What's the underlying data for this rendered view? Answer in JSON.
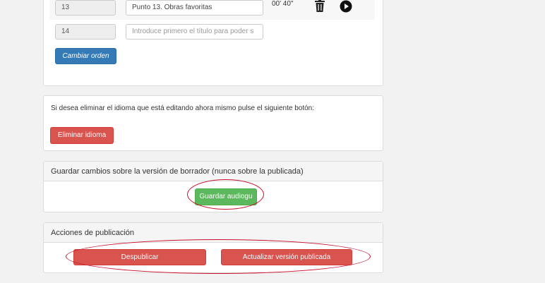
{
  "tracks": [
    {
      "number": "13",
      "title": "Punto 13. Obras favoritas",
      "duration": "00' 40\""
    },
    {
      "number": "14",
      "title_placeholder": "Introduce primero el título para poder s"
    }
  ],
  "reorder_button": "Cambiar orden",
  "language": {
    "message": "Si desea eliminar el idioma que está editando ahora mismo pulse el siguiente botón:",
    "delete_button": "Eliminar idioma"
  },
  "draft": {
    "heading": "Guardar cambios sobre la versión de borrador (nunca sobre la publicada)",
    "save_button": "Guardar audiogu"
  },
  "publish": {
    "heading": "Acciones de publicación",
    "unpublish_button": "Despublicar",
    "update_button": "Actualizar versión publicada"
  },
  "colors": {
    "primary": "#337ab7",
    "danger": "#d9534f",
    "success": "#5cb85c",
    "highlight": "#c8102e"
  },
  "icons": [
    "trash-icon",
    "play-icon"
  ]
}
